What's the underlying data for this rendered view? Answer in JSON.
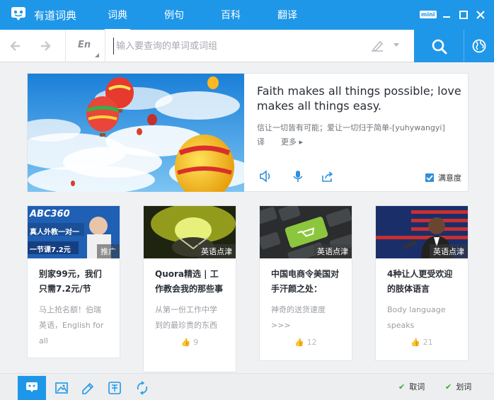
{
  "app": {
    "title": "有道词典",
    "mini_label": "mini"
  },
  "nav": {
    "tabs": [
      {
        "label": "词典"
      },
      {
        "label": "例句"
      },
      {
        "label": "百科"
      },
      {
        "label": "翻译"
      }
    ],
    "active_tab": "词典"
  },
  "search": {
    "lang_label": "En",
    "placeholder": "输入要查询的单词或词组",
    "value": ""
  },
  "featured": {
    "quote": "Faith makes all things possible; love makes all things easy.",
    "translation": "信让一切皆有可能；爱让一切归于简单-[yuhywangyi]",
    "translate_label": "译",
    "more_label": "更多",
    "satisfaction_label": "满意度",
    "satisfaction_checked": true
  },
  "cards": [
    {
      "tag": "推广",
      "banner_brand": "ABC360",
      "banner_line1": "真人外教一对一",
      "banner_line2": "一节课7.2元",
      "title": "别家99元，我们只需7.2元/节",
      "desc": "马上抢名额！伯瑞英语，English for all",
      "likes": ""
    },
    {
      "tag": "英语点津",
      "title": "Quora精选 | 工作教会我的那些事",
      "desc": "从第一份工作中学到的最珍贵的东西",
      "likes": "9"
    },
    {
      "tag": "英语点津",
      "title": "中国电商令美国对手汗颜之处：",
      "desc": "神奇的送货速度 >>>",
      "likes": "12"
    },
    {
      "tag": "英语点津",
      "title": "4种让人更受欢迎的肢体语言",
      "desc": "Body language speaks",
      "likes": "21"
    }
  ],
  "bottom": {
    "toggle_pick": "取词",
    "toggle_select": "划词"
  },
  "colors": {
    "brand_blue": "#1f97e8",
    "check_green": "#38a832"
  }
}
